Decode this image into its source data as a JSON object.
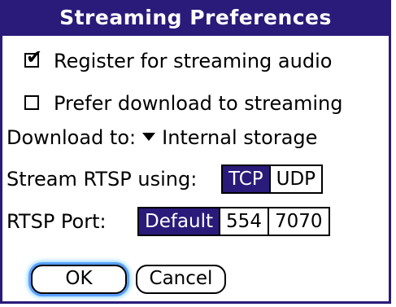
{
  "dialog": {
    "title": "Streaming Preferences",
    "register_label": "Register for streaming audio",
    "register_checked": true,
    "prefer_download_label": "Prefer download to streaming",
    "prefer_download_checked": false,
    "download_to_label": "Download to:",
    "download_to_value": "Internal storage",
    "rtsp_using_label": "Stream RTSP using:",
    "rtsp_using_options": [
      "TCP",
      "UDP"
    ],
    "rtsp_using_selected": "TCP",
    "rtsp_port_label": "RTSP Port:",
    "rtsp_port_options": [
      "Default",
      "554",
      "7070"
    ],
    "rtsp_port_selected": "Default",
    "ok_label": "OK",
    "cancel_label": "Cancel"
  },
  "colors": {
    "accent": "#2a1a7a",
    "focus_glow": "#5aa0ff"
  },
  "icons": {
    "checkmark": "✔",
    "dropdown": "down-triangle-icon"
  }
}
